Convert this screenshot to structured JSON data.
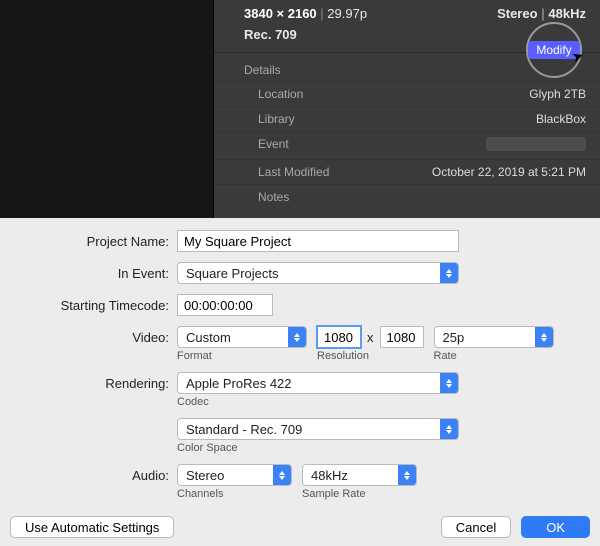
{
  "inspector": {
    "resolution": "3840 × 2160",
    "framerate": "29.97p",
    "audio_label": "Stereo",
    "audio_rate": "48kHz",
    "color_profile": "Rec. 709",
    "modify_label": "Modify",
    "details_header": "Details",
    "rows": {
      "location": {
        "label": "Location",
        "value": "Glyph 2TB"
      },
      "library": {
        "label": "Library",
        "value": "BlackBox"
      },
      "event": {
        "label": "Event",
        "value": ""
      },
      "last_modified": {
        "label": "Last Modified",
        "value": "October 22, 2019 at 5:21 PM"
      },
      "notes": {
        "label": "Notes",
        "value": ""
      }
    }
  },
  "dialog": {
    "project_name": {
      "label": "Project Name:",
      "value": "My Square Project"
    },
    "in_event": {
      "label": "In Event:",
      "value": "Square Projects"
    },
    "starting_timecode": {
      "label": "Starting Timecode:",
      "value": "00:00:00:00"
    },
    "video": {
      "label": "Video:",
      "format": {
        "value": "Custom",
        "sublabel": "Format"
      },
      "resolution": {
        "width": "1080",
        "height": "1080",
        "sublabel": "Resolution",
        "x": "x"
      },
      "rate": {
        "value": "25p",
        "sublabel": "Rate"
      }
    },
    "rendering": {
      "label": "Rendering:",
      "codec": {
        "value": "Apple ProRes 422",
        "sublabel": "Codec"
      },
      "color_space": {
        "value": "Standard - Rec. 709",
        "sublabel": "Color Space"
      }
    },
    "audio": {
      "label": "Audio:",
      "channels": {
        "value": "Stereo",
        "sublabel": "Channels"
      },
      "sample_rate": {
        "value": "48kHz",
        "sublabel": "Sample Rate"
      }
    },
    "buttons": {
      "auto": "Use Automatic Settings",
      "cancel": "Cancel",
      "ok": "OK"
    }
  }
}
